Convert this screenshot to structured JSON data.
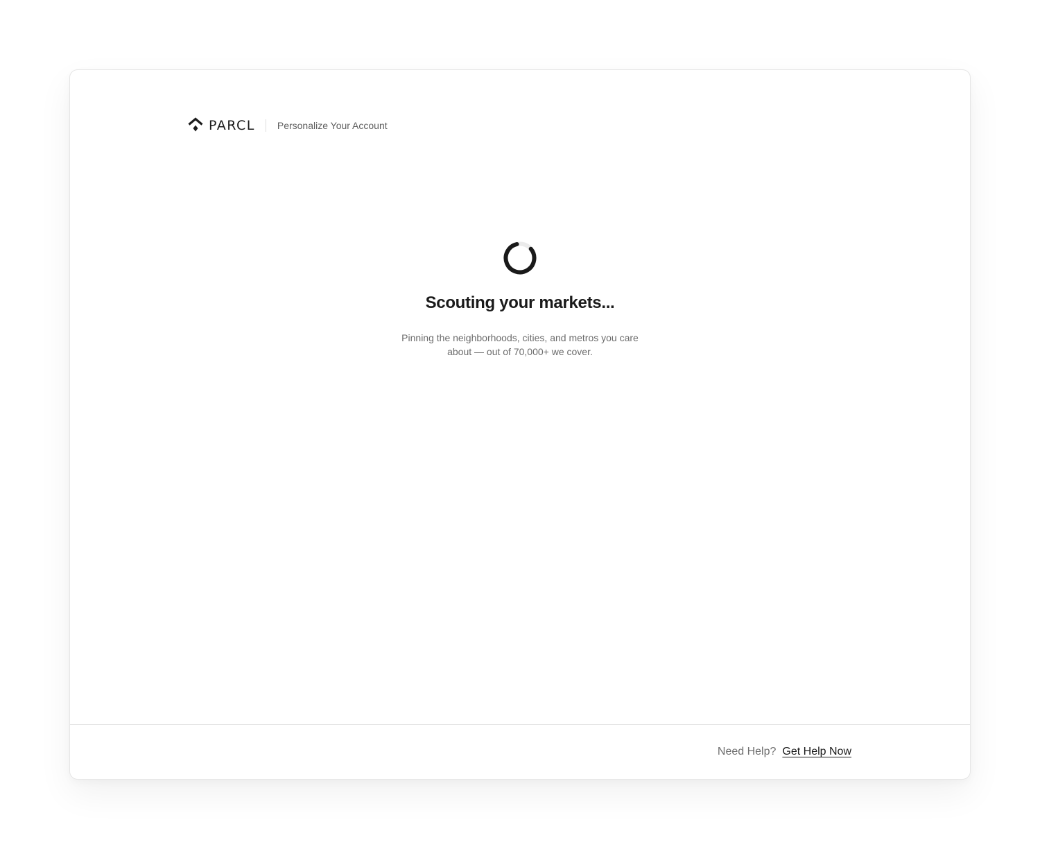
{
  "header": {
    "logo_text": "PARCL",
    "title": "Personalize Your Account",
    "logo_icon": "parcl-logo-icon"
  },
  "loading": {
    "title": "Scouting your markets...",
    "description": "Pinning the neighborhoods, cities, and metros you care about — out of 70,000+ we cover.",
    "spinner_icon": "spinner-icon"
  },
  "footer": {
    "help_prompt": "Need Help?",
    "help_link": "Get Help Now"
  },
  "colors": {
    "text_primary": "#1a1a1a",
    "text_secondary": "#6b6b6b",
    "border": "#e6e6e6",
    "spinner_track": "#ebebeb",
    "spinner_arc": "#1a1a1a"
  }
}
